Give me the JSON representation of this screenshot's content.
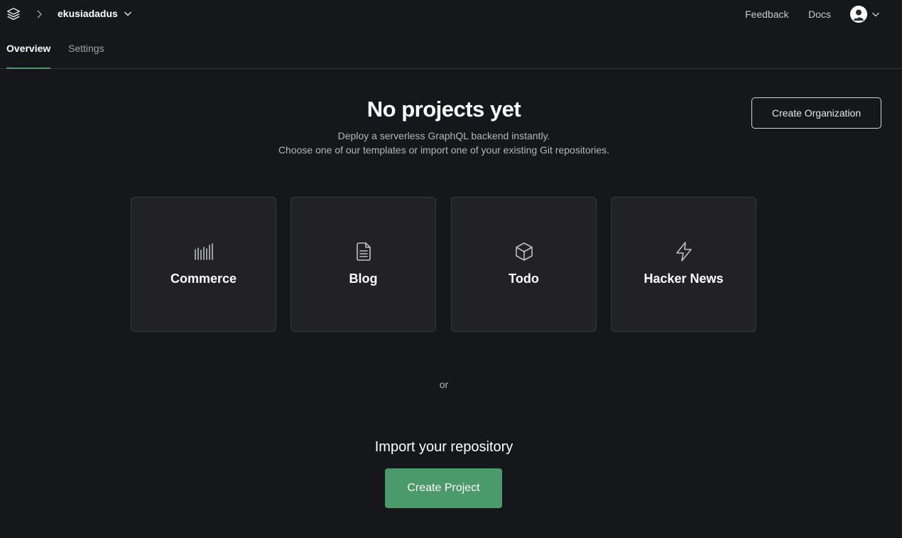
{
  "header": {
    "org_name": "ekusiadadus",
    "feedback_label": "Feedback",
    "docs_label": "Docs"
  },
  "tabs": [
    {
      "label": "Overview",
      "active": true
    },
    {
      "label": "Settings",
      "active": false
    }
  ],
  "main": {
    "title": "No projects yet",
    "subtitle_line1": "Deploy a serverless GraphQL backend instantly.",
    "subtitle_line2": "Choose one of our templates or import one of your existing Git repositories.",
    "create_org_label": "Create Organization",
    "templates": [
      {
        "label": "Commerce",
        "icon": "barcode-icon"
      },
      {
        "label": "Blog",
        "icon": "document-icon"
      },
      {
        "label": "Todo",
        "icon": "cube-icon"
      },
      {
        "label": "Hacker News",
        "icon": "lightning-icon"
      }
    ],
    "or_label": "or",
    "import_title": "Import your repository",
    "create_project_label": "Create Project"
  },
  "colors": {
    "background": "#16171b",
    "card": "#222226",
    "accent": "#4b9a6c"
  }
}
